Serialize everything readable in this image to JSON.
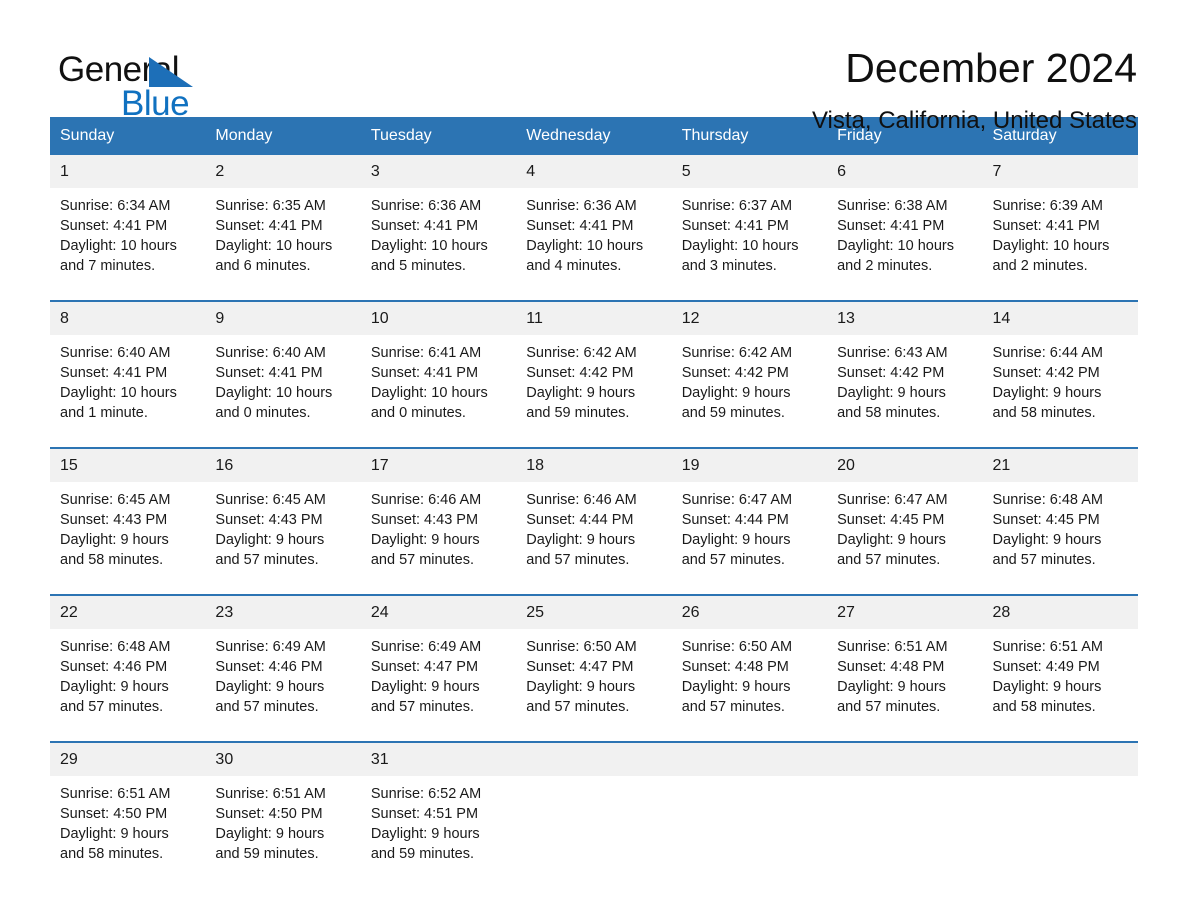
{
  "brand": {
    "name_top": "General",
    "name_bottom": "Blue",
    "accent_color": "#1071c0",
    "triangle_color": "#1d6fb8"
  },
  "header": {
    "title": "December 2024",
    "subtitle": "Vista, California, United States"
  },
  "calendar": {
    "header_bg": "#2c74b3",
    "header_text_color": "#ffffff",
    "daynum_bg": "#f1f1f1",
    "weekday_headers": [
      "Sunday",
      "Monday",
      "Tuesday",
      "Wednesday",
      "Thursday",
      "Friday",
      "Saturday"
    ],
    "weeks": [
      [
        {
          "day": "1",
          "lines": [
            "Sunrise: 6:34 AM",
            "Sunset: 4:41 PM",
            "Daylight: 10 hours",
            "and 7 minutes."
          ]
        },
        {
          "day": "2",
          "lines": [
            "Sunrise: 6:35 AM",
            "Sunset: 4:41 PM",
            "Daylight: 10 hours",
            "and 6 minutes."
          ]
        },
        {
          "day": "3",
          "lines": [
            "Sunrise: 6:36 AM",
            "Sunset: 4:41 PM",
            "Daylight: 10 hours",
            "and 5 minutes."
          ]
        },
        {
          "day": "4",
          "lines": [
            "Sunrise: 6:36 AM",
            "Sunset: 4:41 PM",
            "Daylight: 10 hours",
            "and 4 minutes."
          ]
        },
        {
          "day": "5",
          "lines": [
            "Sunrise: 6:37 AM",
            "Sunset: 4:41 PM",
            "Daylight: 10 hours",
            "and 3 minutes."
          ]
        },
        {
          "day": "6",
          "lines": [
            "Sunrise: 6:38 AM",
            "Sunset: 4:41 PM",
            "Daylight: 10 hours",
            "and 2 minutes."
          ]
        },
        {
          "day": "7",
          "lines": [
            "Sunrise: 6:39 AM",
            "Sunset: 4:41 PM",
            "Daylight: 10 hours",
            "and 2 minutes."
          ]
        }
      ],
      [
        {
          "day": "8",
          "lines": [
            "Sunrise: 6:40 AM",
            "Sunset: 4:41 PM",
            "Daylight: 10 hours",
            "and 1 minute."
          ]
        },
        {
          "day": "9",
          "lines": [
            "Sunrise: 6:40 AM",
            "Sunset: 4:41 PM",
            "Daylight: 10 hours",
            "and 0 minutes."
          ]
        },
        {
          "day": "10",
          "lines": [
            "Sunrise: 6:41 AM",
            "Sunset: 4:41 PM",
            "Daylight: 10 hours",
            "and 0 minutes."
          ]
        },
        {
          "day": "11",
          "lines": [
            "Sunrise: 6:42 AM",
            "Sunset: 4:42 PM",
            "Daylight: 9 hours",
            "and 59 minutes."
          ]
        },
        {
          "day": "12",
          "lines": [
            "Sunrise: 6:42 AM",
            "Sunset: 4:42 PM",
            "Daylight: 9 hours",
            "and 59 minutes."
          ]
        },
        {
          "day": "13",
          "lines": [
            "Sunrise: 6:43 AM",
            "Sunset: 4:42 PM",
            "Daylight: 9 hours",
            "and 58 minutes."
          ]
        },
        {
          "day": "14",
          "lines": [
            "Sunrise: 6:44 AM",
            "Sunset: 4:42 PM",
            "Daylight: 9 hours",
            "and 58 minutes."
          ]
        }
      ],
      [
        {
          "day": "15",
          "lines": [
            "Sunrise: 6:45 AM",
            "Sunset: 4:43 PM",
            "Daylight: 9 hours",
            "and 58 minutes."
          ]
        },
        {
          "day": "16",
          "lines": [
            "Sunrise: 6:45 AM",
            "Sunset: 4:43 PM",
            "Daylight: 9 hours",
            "and 57 minutes."
          ]
        },
        {
          "day": "17",
          "lines": [
            "Sunrise: 6:46 AM",
            "Sunset: 4:43 PM",
            "Daylight: 9 hours",
            "and 57 minutes."
          ]
        },
        {
          "day": "18",
          "lines": [
            "Sunrise: 6:46 AM",
            "Sunset: 4:44 PM",
            "Daylight: 9 hours",
            "and 57 minutes."
          ]
        },
        {
          "day": "19",
          "lines": [
            "Sunrise: 6:47 AM",
            "Sunset: 4:44 PM",
            "Daylight: 9 hours",
            "and 57 minutes."
          ]
        },
        {
          "day": "20",
          "lines": [
            "Sunrise: 6:47 AM",
            "Sunset: 4:45 PM",
            "Daylight: 9 hours",
            "and 57 minutes."
          ]
        },
        {
          "day": "21",
          "lines": [
            "Sunrise: 6:48 AM",
            "Sunset: 4:45 PM",
            "Daylight: 9 hours",
            "and 57 minutes."
          ]
        }
      ],
      [
        {
          "day": "22",
          "lines": [
            "Sunrise: 6:48 AM",
            "Sunset: 4:46 PM",
            "Daylight: 9 hours",
            "and 57 minutes."
          ]
        },
        {
          "day": "23",
          "lines": [
            "Sunrise: 6:49 AM",
            "Sunset: 4:46 PM",
            "Daylight: 9 hours",
            "and 57 minutes."
          ]
        },
        {
          "day": "24",
          "lines": [
            "Sunrise: 6:49 AM",
            "Sunset: 4:47 PM",
            "Daylight: 9 hours",
            "and 57 minutes."
          ]
        },
        {
          "day": "25",
          "lines": [
            "Sunrise: 6:50 AM",
            "Sunset: 4:47 PM",
            "Daylight: 9 hours",
            "and 57 minutes."
          ]
        },
        {
          "day": "26",
          "lines": [
            "Sunrise: 6:50 AM",
            "Sunset: 4:48 PM",
            "Daylight: 9 hours",
            "and 57 minutes."
          ]
        },
        {
          "day": "27",
          "lines": [
            "Sunrise: 6:51 AM",
            "Sunset: 4:48 PM",
            "Daylight: 9 hours",
            "and 57 minutes."
          ]
        },
        {
          "day": "28",
          "lines": [
            "Sunrise: 6:51 AM",
            "Sunset: 4:49 PM",
            "Daylight: 9 hours",
            "and 58 minutes."
          ]
        }
      ],
      [
        {
          "day": "29",
          "lines": [
            "Sunrise: 6:51 AM",
            "Sunset: 4:50 PM",
            "Daylight: 9 hours",
            "and 58 minutes."
          ]
        },
        {
          "day": "30",
          "lines": [
            "Sunrise: 6:51 AM",
            "Sunset: 4:50 PM",
            "Daylight: 9 hours",
            "and 59 minutes."
          ]
        },
        {
          "day": "31",
          "lines": [
            "Sunrise: 6:52 AM",
            "Sunset: 4:51 PM",
            "Daylight: 9 hours",
            "and 59 minutes."
          ]
        },
        {
          "day": "",
          "lines": []
        },
        {
          "day": "",
          "lines": []
        },
        {
          "day": "",
          "lines": []
        },
        {
          "day": "",
          "lines": []
        }
      ]
    ]
  }
}
